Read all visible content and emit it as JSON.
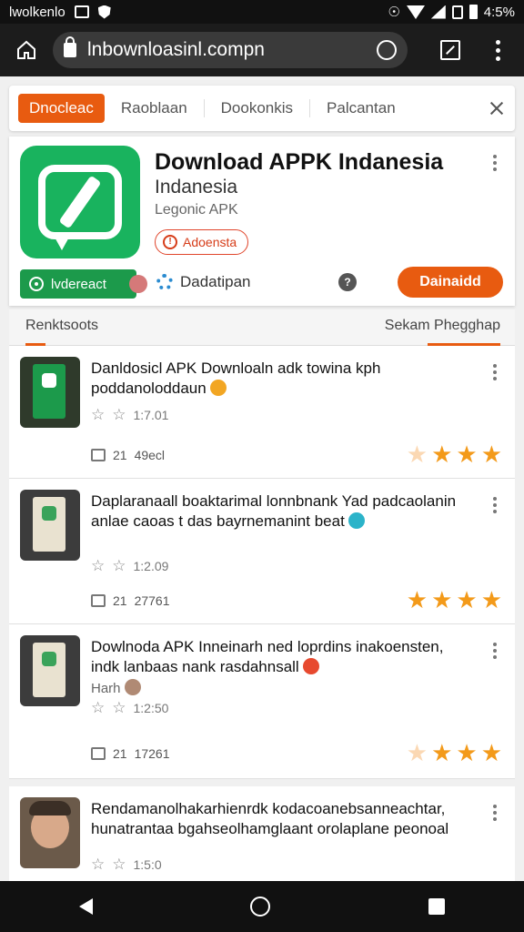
{
  "status_bar": {
    "carrier": "lwolkenlo",
    "battery": "4:5%"
  },
  "browser": {
    "url": "lnbownloasinl.compn"
  },
  "tabs": {
    "active": "Dnocleac",
    "items": [
      "Raoblaan",
      "Dookonkis",
      "Palcantan"
    ]
  },
  "app": {
    "title": "Download APPK Indanesia",
    "subtitle": "Indanesia",
    "developer": "Legonic APK",
    "badge": "Adoensta",
    "verified_label": "lvdereact",
    "category_label": "Dadatipan",
    "download_label": "Dainaidd",
    "accent_color": "#e85b10",
    "brand_color": "#19b35e"
  },
  "section_tabs": {
    "left": "Renktsoots",
    "right": "Sekam Phegghap"
  },
  "posts": [
    {
      "text": "Danldosicl APK Downloaln adk towina kph poddanoloddaun",
      "emoji_color": "#f2a623",
      "meta": "1:7.01",
      "likes": "21",
      "stat": "49ecl",
      "rating": 4
    },
    {
      "text": "Daplaranaall boaktarimal lonnbnank Yad padcaolanin anlae caoas t das bayrnemanint beat",
      "emoji_color": "#2bb3c9",
      "meta": "1:2.09",
      "likes": "21",
      "stat": "27761",
      "rating": 4
    },
    {
      "text": "Dowlnoda APK Inneinarh ned loprdins inakoensten, indk lanbaas nank rasdahnsall",
      "emoji_color": "#e7492f",
      "extra": "Harh",
      "meta": "1:2:50",
      "likes": "21",
      "stat": "17261",
      "rating": 3
    },
    {
      "text": "Rendamanolhakarhienrdk kodacoanebsanneachtar, hunatrantaa bgahseolhamglaant orolaplane peonoal",
      "meta": "1:5:0",
      "rating": 0
    }
  ]
}
